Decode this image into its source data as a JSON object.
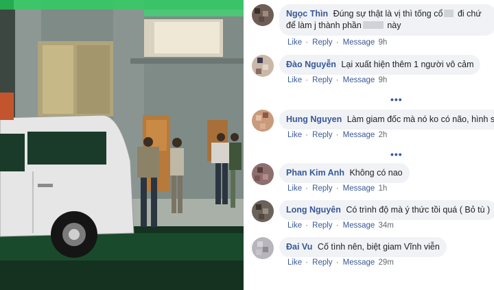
{
  "actions": {
    "like": "Like",
    "reply": "Reply",
    "message": "Message"
  },
  "more_replies": "•••",
  "comments": [
    {
      "author": "Ngọc Thìn",
      "text_a": "Đúng sự thật là vị thì tống cổ",
      "text_b": "đi chứ để làm j",
      "text_c": "thành phần",
      "text_d": "này",
      "time": "9h"
    },
    {
      "author": "Đào Nguyễn",
      "text": "Lại xuất hiện thêm 1 người vô cảm",
      "time": "9h"
    },
    {
      "author": "Hung Nguyen",
      "text": "Làm giam đốc mà nó ko có não, hình sự",
      "time": "2h"
    },
    {
      "author": "Phan Kim Anh",
      "text": "Không có nao",
      "time": "1h"
    },
    {
      "author": "Long Nguyên",
      "text": "Có trình độ mà ý thức tồi quá ( Bỏ tù )",
      "time": "34m"
    },
    {
      "author": "Đai Vu",
      "text": "Cố tình nên, biệt giam Vĩnh viễn",
      "time": "29m"
    }
  ]
}
